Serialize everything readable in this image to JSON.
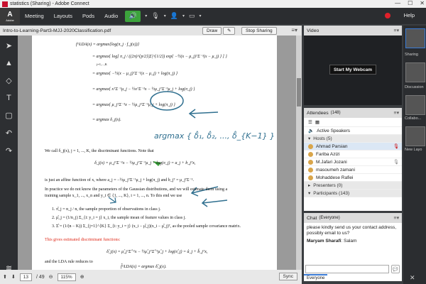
{
  "window": {
    "title": "statistics (Sharing) - Adobe Connect",
    "logo": "Adobe"
  },
  "menu": [
    "Meeting",
    "Layouts",
    "Pods",
    "Audio"
  ],
  "header": {
    "help": "Help"
  },
  "doc": {
    "filename": "Intro-to-Learning-Part3-MJJ-2020Classification.pdf",
    "draw": "Draw",
    "stop_sharing": "Stop Sharing",
    "page_current": "13",
    "page_total": "/ 49",
    "zoom": "115%",
    "sync": "Sync"
  },
  "content": {
    "eq1": "f^LDA(x) = argmax{log(π_j · f_j(x))}",
    "eq2": "= argmax{ log[ π_j / ((2π)^{p/2}|Σ|^{1/2}) exp{ −½(x − μ_j)ᵀΣ⁻¹(x − μ_j) } ] }",
    "eq3": "= argmax{ −½(x − μ_j)ᵀΣ⁻¹(x − μ_j) + log(π_j) }",
    "eq4": "= argmax{ xᵀΣ⁻¹μ_j − ½xᵀΣ⁻¹x − ½μ_jᵀΣ⁻¹μ_j + log(π_j) }",
    "eq5": "= argmax{ μ_jᵀΣ⁻¹x − ½μ_jᵀΣ⁻¹μ_j + log(π_j) }",
    "eq6": "= argmax δ_j(x).",
    "under": "j=1,...,K",
    "p1": "We call δ_j(x), j = 1, ..., K, the discriminant functions. Note that",
    "eq7": "δ_j(x) = μ_jᵀΣ⁻¹x − ½μ_jᵀΣ⁻¹μ_j + log(π_j) = a_j + b_jᵀx,",
    "p2": "is just an affine function of x, where a_j = −½μ_jᵀΣ⁻¹μ_j + log(π_j) and b_jᵀ = μ_jᵀΣ⁻¹.",
    "p3": "In practice we do not know the parameters of the Gaussian distributions, and we will estimate them using a",
    "p3b": "training sample x_1, ..., x_n and y_i ∈ {1, ..., K}, i = 1, ..., n. To this end we use",
    "li1": "1. π̂_j = n_j / n, the sample proportion of observations in class j.",
    "li2": "2. μ̂_j = (1/n_j) Σ_{i: y_i = j} x_i, the sample mean of feature values in class j.",
    "li3": "3. Σ̂ = (1/(n − K)) Σ_{j=1}^{K} Σ_{i: y_i = j} (x_i − μ̂_j)(x_i − μ̂_j)ᵀ, as the pooled sample covariance matrix.",
    "p4": "This gives estimated discriminant functions:",
    "eq8": "δ̂_j(x) = μ̂_jᵀΣ̂⁻¹x − ½μ̂_jᵀΣ̂⁻¹μ̂_j + log(π̂_j) = â_j + b̂_jᵀx,",
    "p5": "and the LDA rule reduces to",
    "eq9": "f̂^LDA(x) = argmax δ̂_j(x).",
    "ink": "argmax { δ̂₁, δ̂₂, ..., δ̂_{K−1} }"
  },
  "video": {
    "title": "Video",
    "webcam": "Start My Webcam"
  },
  "attendees": {
    "title": "Attendees",
    "count": "(148)",
    "active": "Active Speakers",
    "hosts": "Hosts (5)",
    "names": [
      "Ahmad Parsian",
      "Fariba Azizi",
      "M.Jafari Jozani",
      "masoumeh zamani",
      "Mohaddese Rafiei"
    ],
    "presenters": "Presenters (0)",
    "participants": "Participants (143)"
  },
  "chat": {
    "title": "Chat",
    "scope": "(Everyone)",
    "msg1": "please kindly send us your contact address, possibly email to us?",
    "sender": "Maryam Sharafi",
    "msg2": ": Salam",
    "tab": "Everyone"
  },
  "layouts": [
    "Sharing",
    "Discussion",
    "Collabo...",
    "New Layo"
  ],
  "colors": {
    "accent_green": "#3ca33c",
    "ink_blue": "#2f6f8f",
    "red_text": "#e02a1a",
    "record": "#e0202a"
  }
}
